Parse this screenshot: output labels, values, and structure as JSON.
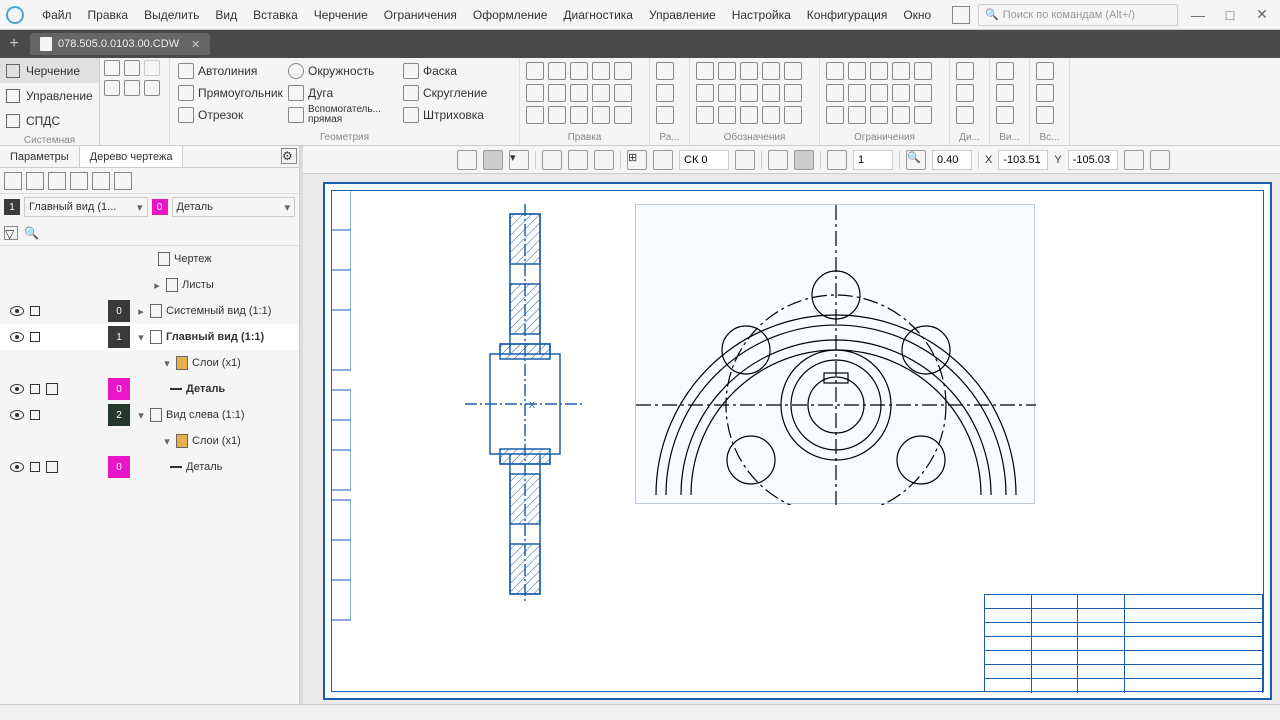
{
  "menu": {
    "items": [
      "Файл",
      "Правка",
      "Выделить",
      "Вид",
      "Вставка",
      "Черчение",
      "Ограничения",
      "Оформление",
      "Диагностика",
      "Управление",
      "Настройка",
      "Конфигурация",
      "Окно"
    ],
    "search_placeholder": "Поиск по командам (Alt+/)"
  },
  "doc_tab": {
    "filename": "078.505.0.0103.00.CDW"
  },
  "left_ribbon": {
    "items": [
      "Черчение",
      "Управление",
      "СПДС"
    ],
    "footer": "Системная"
  },
  "toolbar_geometry": {
    "row1": [
      "Автолиния",
      "Окружность",
      "Фаска"
    ],
    "row2": [
      "Прямоугольник",
      "Дуга",
      "Скругление"
    ],
    "row3": [
      "Отрезок",
      "Вспомогатель... прямая",
      "Штриховка"
    ],
    "label": "Геометрия"
  },
  "toolbar_groups": [
    "Правка",
    "Ра...",
    "Обозначения",
    "Ограничения",
    "Ди...",
    "Ви...",
    "Вс..."
  ],
  "sidebar": {
    "tab1": "Параметры",
    "tab2": "Дерево чертежа",
    "view_select": "Главный вид (1...",
    "view_badge": "1",
    "layer_select": "Деталь",
    "layer_badge": "0",
    "tree": {
      "root": "Чертеж",
      "sheets": "Листы",
      "sysview": "Системный вид (1:1)",
      "mainview": "Главный вид (1:1)",
      "layers1": "Слои (x1)",
      "detail1": "Деталь",
      "leftview": "Вид слева (1:1)",
      "layers2": "Слои (x1)",
      "detail2": "Деталь"
    },
    "badges": {
      "sys": "0",
      "main": "1",
      "main_layer": "0",
      "left": "2",
      "left_layer": "0"
    }
  },
  "canvas_toolbar": {
    "cs_label": "СК 0",
    "scale": "1",
    "zoom": "0.40",
    "x_label": "X",
    "x_val": "-103.51",
    "y_label": "Y",
    "y_val": "-105.03"
  }
}
